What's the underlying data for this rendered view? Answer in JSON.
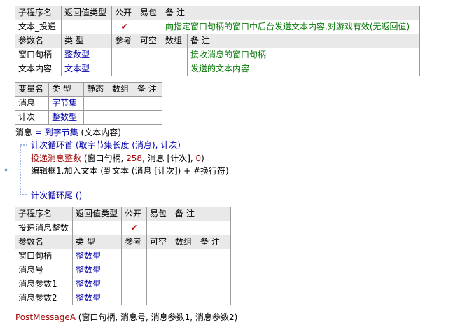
{
  "table1": {
    "header": [
      "子程序名",
      "返回值类型",
      "公开",
      "易包",
      "备 注"
    ],
    "row": {
      "name": "文本_投递",
      "ret": "",
      "public": "✔",
      "epack": "",
      "remark": "向指定窗口句柄的窗口中后台发送文本内容,对游戏有效(无返回值)"
    },
    "param_header": [
      "参数名",
      "类 型",
      "参考",
      "可空",
      "数组",
      "备 注"
    ],
    "params": [
      {
        "name": "窗口句柄",
        "type": "整数型",
        "ref": "",
        "opt": "",
        "arr": "",
        "remark": "接收消息的窗口句柄"
      },
      {
        "name": "文本内容",
        "type": "文本型",
        "ref": "",
        "opt": "",
        "arr": "",
        "remark": "发送的文本内容"
      }
    ]
  },
  "table2": {
    "header": [
      "变量名",
      "类 型",
      "静态",
      "数组",
      "备 注"
    ],
    "vars": [
      {
        "name": "消息",
        "type": "字节集",
        "static": "",
        "arr": "",
        "remark": ""
      },
      {
        "name": "计次",
        "type": "整数型",
        "static": "",
        "arr": "",
        "remark": ""
      }
    ]
  },
  "code": {
    "line1_var": "消息",
    "line1_op": " = ",
    "line1_fn": "到字节集",
    "line1_arg": " (文本内容)",
    "loop_start": "计次循环首 (取字节集长度 (消息), 计次)",
    "line3_fn": "投递消息整数",
    "line3_a": " (窗口句柄, ",
    "line3_num1": "258",
    "line3_b": ", 消息 [计次], ",
    "line3_num2": "0",
    "line3_c": ")",
    "line4": "编辑框1.加入文本 (到文本 (消息 [计次]) + #换行符)",
    "loop_end": "计次循环尾 ()",
    "last_fn": "PostMessageA",
    "last_args": " (窗口句柄, 消息号, 消息参数1, 消息参数2)",
    "marker": "»"
  },
  "table3": {
    "header": [
      "子程序名",
      "返回值类型",
      "公开",
      "易包",
      "备 注"
    ],
    "row": {
      "name": "投递消息整数",
      "ret": "",
      "public": "✔",
      "epack": "",
      "remark": ""
    },
    "param_header": [
      "参数名",
      "类 型",
      "参考",
      "可空",
      "数组",
      "备 注"
    ],
    "params": [
      {
        "name": "窗口句柄",
        "type": "整数型"
      },
      {
        "name": "消息号",
        "type": "整数型"
      },
      {
        "name": "消息参数1",
        "type": "整数型"
      },
      {
        "name": "消息参数2",
        "type": "整数型"
      }
    ]
  }
}
